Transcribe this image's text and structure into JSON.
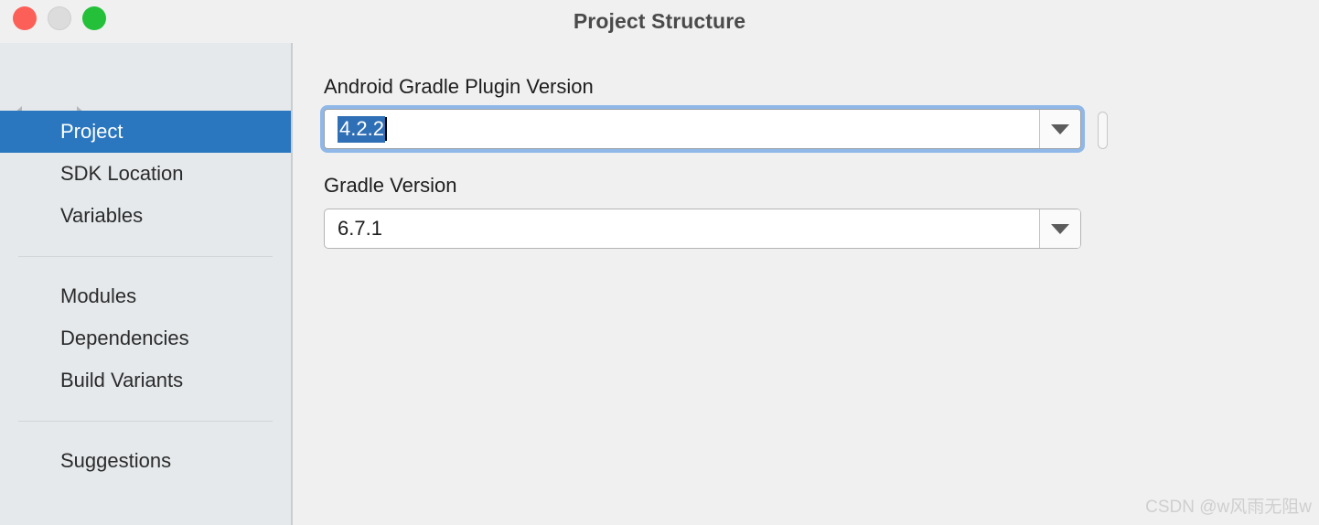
{
  "window": {
    "title": "Project Structure",
    "traffic_lights": {
      "close_color": "#fc5f58",
      "minimize_color": "#dcdcdc",
      "maximize_color": "#24c03a"
    }
  },
  "toolbar": {
    "back_label": "Back",
    "forward_label": "Forward"
  },
  "sidebar": {
    "groups": [
      {
        "items": [
          {
            "label": "Project",
            "selected": true
          },
          {
            "label": "SDK Location",
            "selected": false
          },
          {
            "label": "Variables",
            "selected": false
          }
        ]
      },
      {
        "items": [
          {
            "label": "Modules",
            "selected": false
          },
          {
            "label": "Dependencies",
            "selected": false
          },
          {
            "label": "Build Variants",
            "selected": false
          }
        ]
      },
      {
        "items": [
          {
            "label": "Suggestions",
            "selected": false
          }
        ]
      }
    ],
    "selected_color": "#2a76bf",
    "background_color": "#e5e9ec"
  },
  "main": {
    "fields": [
      {
        "label": "Android Gradle Plugin Version",
        "value": "4.2.2",
        "focused": true,
        "text_selected": true
      },
      {
        "label": "Gradle Version",
        "value": "6.7.1",
        "focused": false,
        "text_selected": false
      }
    ],
    "focus_ring_color": "#8fb8e8",
    "selection_color": "#2f6fb5"
  },
  "watermark": {
    "text": "CSDN @w风雨无阻w"
  }
}
